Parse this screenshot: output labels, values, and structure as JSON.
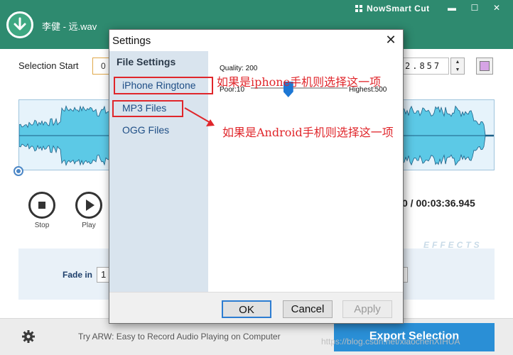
{
  "app": {
    "title": "李健 - 远.wav",
    "brand": "NowSmart Cut",
    "window_buttons": [
      "▬",
      "☐",
      "✕"
    ],
    "selection_start_label": "Selection Start",
    "selection_start_value": "0",
    "selection_end_value": "2.857",
    "controls": [
      {
        "label": "Stop",
        "icon": "stop-icon"
      },
      {
        "label": "Play",
        "icon": "play-icon"
      }
    ],
    "time_readout": "0 / 00:03:36.945",
    "effects_label": "EFFECTS",
    "fade_in_label": "Fade in",
    "fade_in_value": "1",
    "promo_text": "Try ARW: Easy to Record Audio Playing on Computer",
    "export_label": "Export Selection",
    "watermark": "https://blog.csdn.net/xiaochenXIHUA",
    "colors": {
      "titlebar": "#2e8a6f",
      "wave": "#5cc9e6",
      "export": "#2a8fd6",
      "annotation": "#e0262b"
    }
  },
  "dialog": {
    "title": "Settings",
    "close_label": "✕",
    "sidebar_heading": "File Settings",
    "sidebar_items": [
      "iPhone Ringtone",
      "MP3 Files",
      "OGG Files"
    ],
    "quality_label": "Quality: 200",
    "quality_min_label": "Poor:10",
    "quality_max_label": "Highest:500",
    "quality_value": 200,
    "quality_min": 10,
    "quality_max": 500,
    "buttons": {
      "ok": "OK",
      "cancel": "Cancel",
      "apply": "Apply"
    }
  },
  "annotations": {
    "iphone_note": "如果是iphone手机则选择这一项",
    "android_note": "如果是Android手机则选择这一项"
  }
}
